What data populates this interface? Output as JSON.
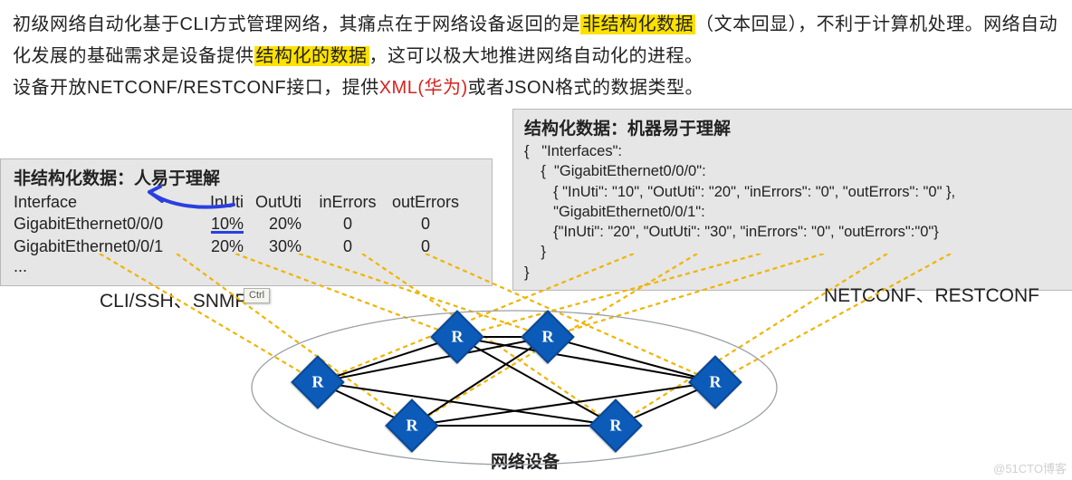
{
  "para": {
    "t1a": "初级网络自动化基于CLI方式管理网络，其痛点在于网络设备返回的是",
    "hl1": "非结构化数据",
    "t1b": "（文本回显），不利于计算机处理。网络自动化发展的基础需求是设备提供",
    "hl2": "结构化的数据",
    "t1c": "，这可以极大地推进网络自动化的进程。",
    "t2a": "设备开放NETCONF/RESTCONF接口，提供",
    "red": "XML(华为)",
    "t2b": "或者JSON格式的数据类型。"
  },
  "left": {
    "title": "非结构化数据：人易于理解",
    "h_if": "Interface",
    "h_in": "InUti",
    "h_out": "OutUti",
    "h_ie": "inErrors",
    "h_oe": "outErrors",
    "rows": [
      {
        "if": "GigabitEthernet0/0/0",
        "in": "10%",
        "out": "20%",
        "ie": "0",
        "oe": "0"
      },
      {
        "if": "GigabitEthernet0/0/1",
        "in": "20%",
        "out": "30%",
        "ie": "0",
        "oe": "0"
      }
    ],
    "more": "..."
  },
  "right": {
    "title": "结构化数据：机器易于理解",
    "json": "{   \"Interfaces\":\n    {  \"GigabitEthernet0/0/0\":\n       { \"InUti\": \"10\", \"OutUti\": \"20\", \"inErrors\": \"0\", \"outErrors\": \"0\" },\n       \"GigabitEthernet0/0/1\":\n       {\"InUti\": \"20\", \"OutUti\": \"30\", \"inErrors\": \"0\", \"outErrors\":\"0\"}\n    }\n}"
  },
  "diagram": {
    "left_label": "CLI/SSH、SNMP",
    "right_label": "NETCONF、RESTCONF",
    "bottom_label": "网络设备",
    "ctrl": "Ctrl"
  },
  "watermark": "@51CTO博客"
}
